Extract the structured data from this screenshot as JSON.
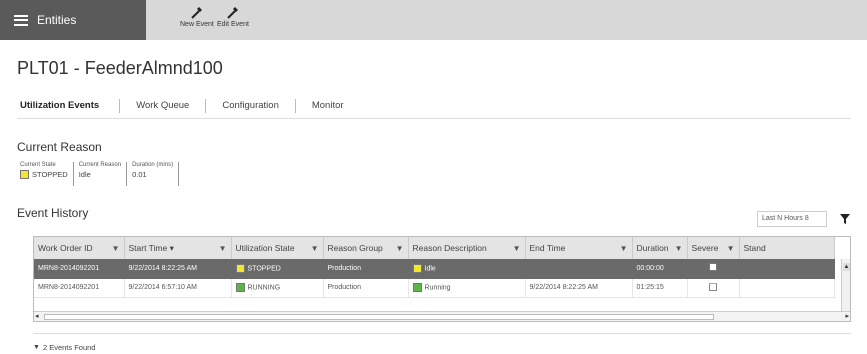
{
  "toolbar": {
    "entities_label": "Entities",
    "new_event_label": "New Event",
    "edit_event_label": "Edit Event"
  },
  "page": {
    "title": "PLT01 - FeederAlmnd100"
  },
  "tabs": [
    {
      "label": "Utilization Events",
      "active": true
    },
    {
      "label": "Work Queue",
      "active": false
    },
    {
      "label": "Configuration",
      "active": false
    },
    {
      "label": "Monitor",
      "active": false
    }
  ],
  "current_reason": {
    "section_title": "Current Reason",
    "state_label": "Current State",
    "state_value": "STOPPED",
    "state_color": "#f3e62f",
    "reason_label": "Current Reason",
    "reason_value": "Idle",
    "duration_label": "Duration (mins)",
    "duration_value": "0.01"
  },
  "event_history": {
    "section_title": "Event History",
    "filter_label": "Last N Hours",
    "filter_value": "8",
    "columns": [
      "Work Order ID",
      "Start Time",
      "Utilization State",
      "Reason Group",
      "Reason Description",
      "End Time",
      "Duration",
      "Severe",
      "Stand"
    ],
    "rows": [
      {
        "work_order": "MRN8-2014092201",
        "start_time": "9/22/2014 8:22:25 AM",
        "state": "STOPPED",
        "state_color": "#f3e62f",
        "reason_group": "Production",
        "reason_desc": "Idle",
        "reason_color": "#f3e62f",
        "end_time": "",
        "duration": "00:00:00",
        "severe": true,
        "selected": true
      },
      {
        "work_order": "MRN8-2014092201",
        "start_time": "9/22/2014 6:57:10 AM",
        "state": "RUNNING",
        "state_color": "#5db54a",
        "reason_group": "Production",
        "reason_desc": "Running",
        "reason_color": "#5db54a",
        "end_time": "9/22/2014 8:22:25 AM",
        "duration": "01:25:15",
        "severe": false,
        "selected": false
      }
    ],
    "footer": "2 Events Found"
  }
}
